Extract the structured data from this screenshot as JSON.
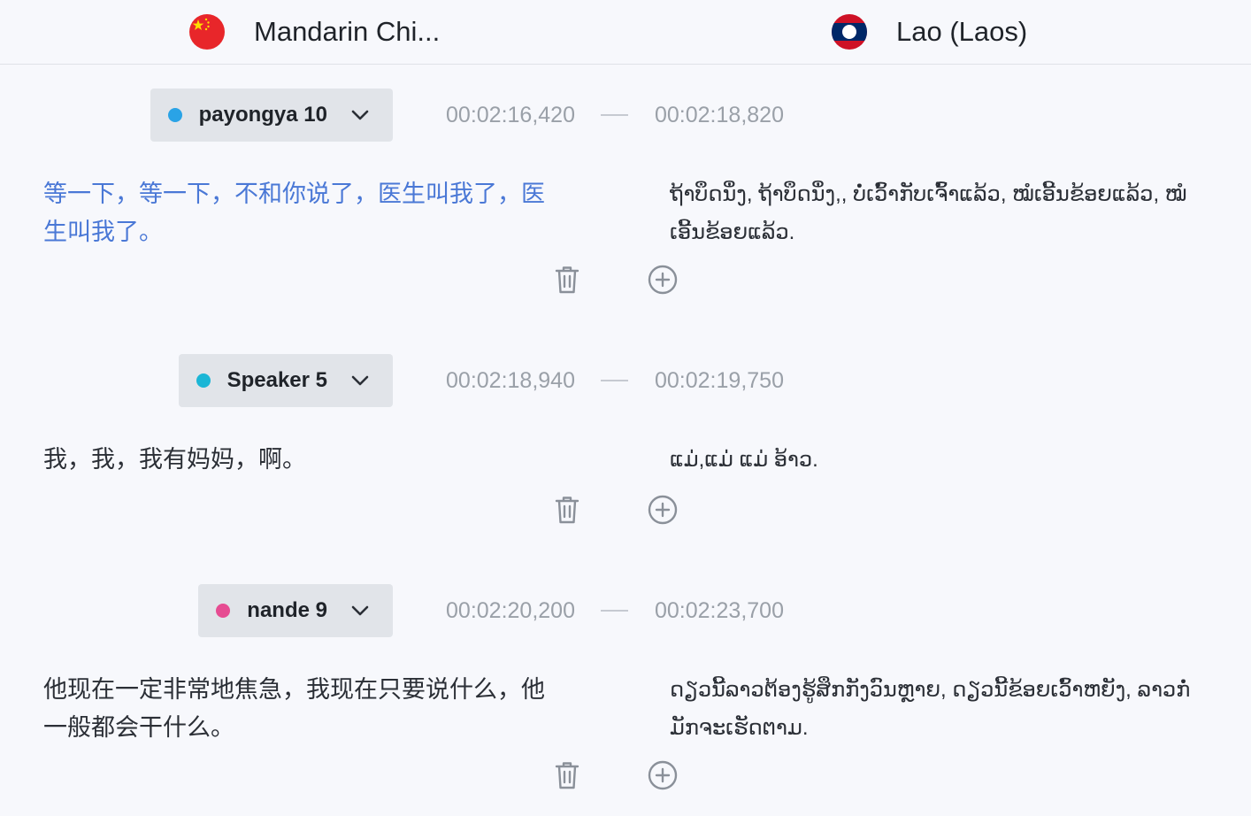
{
  "source_language": {
    "name": "Mandarin Chi...",
    "flag": "china-flag-icon"
  },
  "target_language": {
    "name": "Lao (Laos)",
    "flag": "laos-flag-icon"
  },
  "colors": {
    "active_text": "#4a78d6",
    "speaker_dot_blue": "#2aa3e6",
    "speaker_dot_cyan": "#1bb6d6",
    "speaker_dot_pink": "#e64c92"
  },
  "segments": [
    {
      "speaker": "payongya 10",
      "dot_color": "#2aa3e6",
      "start": "00:02:16,420",
      "end": "00:02:18,820",
      "source_text": "等一下，等一下，不和你说了，医生叫我了，医生叫我了。",
      "target_text": "ຖ້າບຶດນຶ່ງ, ຖ້າບຶດນຶ່ງ,, ບໍ່ເວົ້າກັບເຈົ້າແລ້ວ, ໝໍເອີ້ນຂ້ອຍແລ້ວ, ໝໍເອີ້ນຂ້ອຍແລ້ວ."
    },
    {
      "speaker": "Speaker 5",
      "dot_color": "#1bb6d6",
      "start": "00:02:18,940",
      "end": "00:02:19,750",
      "source_text": "我，我，我有妈妈，啊。",
      "target_text": "ແມ່,ແມ່ ແມ່ ອ້າວ."
    },
    {
      "speaker": "nande 9",
      "dot_color": "#e64c92",
      "start": "00:02:20,200",
      "end": "00:02:23,700",
      "source_text": "他现在一定非常地焦急，我现在只要说什么，他一般都会干什么。",
      "target_text": "ດຽວນີ້ລາວຕ້ອງຮູ້ສຶກກັງວົນຫຼາຍ, ດຽວນີ້ຂ້ອຍເວົ້າຫຍັງ, ລາວກໍ່ມັກຈະເຮັດຕາມ."
    }
  ]
}
